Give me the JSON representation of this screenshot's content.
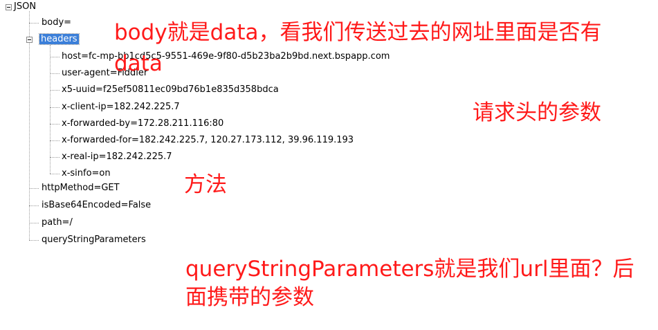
{
  "tree": {
    "root": "JSON",
    "body": "body=",
    "headers": "headers",
    "header_items": [
      "host=fc-mp-bb1cd5c5-9551-469e-9f80-d5b23ba2b9bd.next.bspapp.com",
      "user-agent=Fiddler",
      "x5-uuid=f25ef50811ec09bd76b1e835d358bdca",
      "x-client-ip=182.242.225.7",
      "x-forwarded-by=172.28.211.116:80",
      "x-forwarded-for=182.242.225.7, 120.27.173.112, 39.96.119.193",
      "x-real-ip=182.242.225.7",
      "x-sinfo=on"
    ],
    "httpMethod": "httpMethod=GET",
    "isBase64Encoded": "isBase64Encoded=False",
    "path": "path=/",
    "queryStringParameters": "queryStringParameters"
  },
  "annotations": {
    "body_note_line1": "body就是data，看我们传送过去的网址里面是否有",
    "body_note_line2": "data",
    "headers_note": "请求头的参数",
    "method_note": "方法",
    "query_note_line1": "queryStringParameters就是我们url里面？后",
    "query_note_line2": "面携带的参数"
  },
  "colors": {
    "annotation": "#ff1a1a",
    "selection": "#3b7fd9"
  }
}
